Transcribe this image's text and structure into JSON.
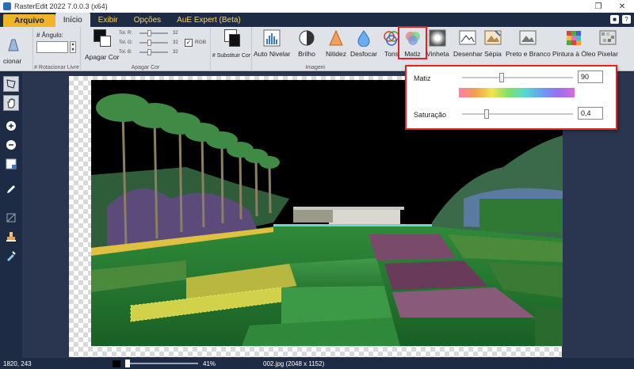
{
  "window": {
    "title": "RasterEdit 2022 7.0.0.3 (x64)"
  },
  "menu": {
    "tabs": [
      "Arquivo",
      "Início",
      "Exibir",
      "Opções",
      "AuE Expert (Beta)"
    ]
  },
  "ribbon": {
    "rotate_button": "cionar",
    "angle_label": "# Ângulo:",
    "rotate_group_label": "# Rotacionar Livre",
    "erase_color_button": "Apagar Cor",
    "tol_r": "Tol. R:",
    "tol_g": "Tol. G:",
    "tol_b": "Tol. B:",
    "tol_r_value": "32",
    "tol_g_value": "32",
    "tol_b_value": "32",
    "rgb_label": "RGB",
    "erase_group_label": "Apagar Cor",
    "substitute_button": "# Substituir Cor",
    "image_group_label": "Imagem",
    "image_buttons": [
      "Auto Nivelar",
      "Brilho",
      "Nitidez",
      "Desfocar",
      "Tons",
      "Matiz",
      "Vinheta",
      "Desenhar",
      "Sépia",
      "Preto e Branco",
      "Pintura à Óleo",
      "Pixelar"
    ],
    "matiz_popup": {
      "hue_label": "Matiz",
      "hue_value": "90",
      "saturation_label": "Saturação",
      "saturation_value": "0,4"
    }
  },
  "toolbar": {
    "icons": [
      "select-icon",
      "hand-icon",
      "zoom-in-icon",
      "zoom-out-icon",
      "fit-icon",
      "pen-icon",
      "crop-icon",
      "stamp-icon",
      "eyedropper-icon"
    ]
  },
  "status": {
    "coords": "1820, 243",
    "zoom": "41%",
    "file": "002.jpg (2048 x 1152)"
  },
  "colors": {
    "dark": "#1e2b45",
    "ribbon": "#dfe3e8",
    "accent": "#f0b429",
    "highlight": "#e02424"
  }
}
